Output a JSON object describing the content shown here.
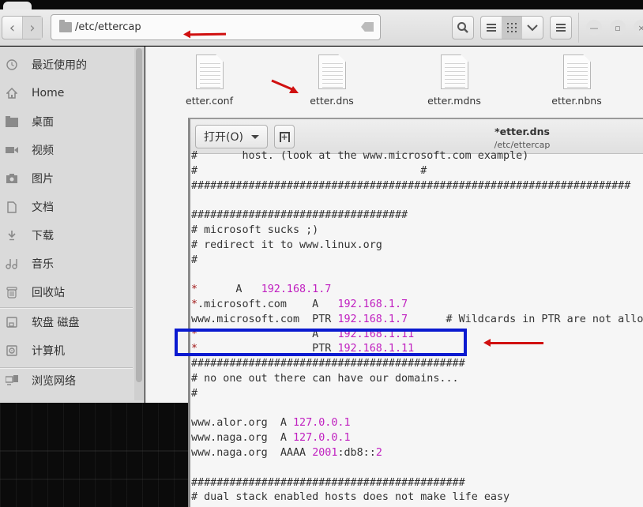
{
  "window": {
    "path": "/etc/ettercap",
    "buttons": {
      "back": "back",
      "forward": "forward",
      "search": "search",
      "list_view": "list",
      "grid_view": "grid",
      "view_options": "view options",
      "menu": "menu",
      "minimize": "minimize",
      "maximize": "maximize",
      "close": "close"
    }
  },
  "sidebar": {
    "items": [
      {
        "label": "最近使用的",
        "icon": "clock-icon"
      },
      {
        "label": "Home",
        "icon": "home-icon"
      },
      {
        "label": "桌面",
        "icon": "folder-icon"
      },
      {
        "label": "视频",
        "icon": "video-icon"
      },
      {
        "label": "图片",
        "icon": "camera-icon"
      },
      {
        "label": "文档",
        "icon": "document-icon"
      },
      {
        "label": "下载",
        "icon": "download-icon"
      },
      {
        "label": "音乐",
        "icon": "music-icon"
      },
      {
        "label": "回收站",
        "icon": "trash-icon"
      },
      {
        "label": "软盘 磁盘",
        "icon": "floppy-icon"
      },
      {
        "label": "计算机",
        "icon": "computer-icon"
      },
      {
        "label": "浏览网络",
        "icon": "network-icon"
      }
    ]
  },
  "files": [
    {
      "name": "etter.conf"
    },
    {
      "name": "etter.dns"
    },
    {
      "name": "etter.mdns"
    },
    {
      "name": "etter.nbns"
    }
  ],
  "editor": {
    "open_label": "打开(O)",
    "title": "*etter.dns",
    "subtitle": "/etc/ettercap",
    "lines": [
      [
        {
          "t": "#       host. (look at the www.microsoft.com example)"
        }
      ],
      [
        {
          "t": "#                                   #"
        }
      ],
      [
        {
          "t": "#####################################################################"
        }
      ],
      [
        {
          "t": ""
        }
      ],
      [
        {
          "t": "##################################"
        }
      ],
      [
        {
          "t": "# microsoft sucks ;)"
        }
      ],
      [
        {
          "t": "# redirect it to www.linux.org"
        }
      ],
      [
        {
          "t": "#"
        }
      ],
      [
        {
          "t": ""
        }
      ],
      [
        {
          "t": "*",
          "c": "star"
        },
        {
          "t": "      A   "
        },
        {
          "t": "192.168.1.7",
          "c": "ip"
        }
      ],
      [
        {
          "t": "*",
          "c": "star"
        },
        {
          "t": ".microsoft.com    A   "
        },
        {
          "t": "192.168.1.7",
          "c": "ip"
        }
      ],
      [
        {
          "t": "www.microsoft.com  PTR "
        },
        {
          "t": "192.168.1.7",
          "c": "ip"
        },
        {
          "t": "      # Wildcards in PTR are not allowed"
        }
      ],
      [
        {
          "t": "*",
          "c": "star"
        },
        {
          "t": "                  A   "
        },
        {
          "t": "192.168.1.11",
          "c": "ip"
        }
      ],
      [
        {
          "t": "*",
          "c": "star"
        },
        {
          "t": "                  PTR "
        },
        {
          "t": "192.168.1.11",
          "c": "ip"
        }
      ],
      [
        {
          "t": "###########################################"
        }
      ],
      [
        {
          "t": "# no one out there can have our domains..."
        }
      ],
      [
        {
          "t": "#"
        }
      ],
      [
        {
          "t": ""
        }
      ],
      [
        {
          "t": "www.alor.org  A "
        },
        {
          "t": "127.0.0.1",
          "c": "ip"
        }
      ],
      [
        {
          "t": "www.naga.org  A "
        },
        {
          "t": "127.0.0.1",
          "c": "ip"
        }
      ],
      [
        {
          "t": "www.naga.org  AAAA "
        },
        {
          "t": "2001",
          "c": "ip"
        },
        {
          "t": ":db8::"
        },
        {
          "t": "2",
          "c": "ip"
        }
      ],
      [
        {
          "t": ""
        }
      ],
      [
        {
          "t": "###########################################"
        }
      ],
      [
        {
          "t": "# dual stack enabled hosts does not make life easy"
        }
      ]
    ]
  },
  "colors": {
    "ip_literal": "#c020c0",
    "wildcard": "#a01818",
    "annotation_red": "#d01010",
    "annotation_blue": "#0a1ad0"
  }
}
